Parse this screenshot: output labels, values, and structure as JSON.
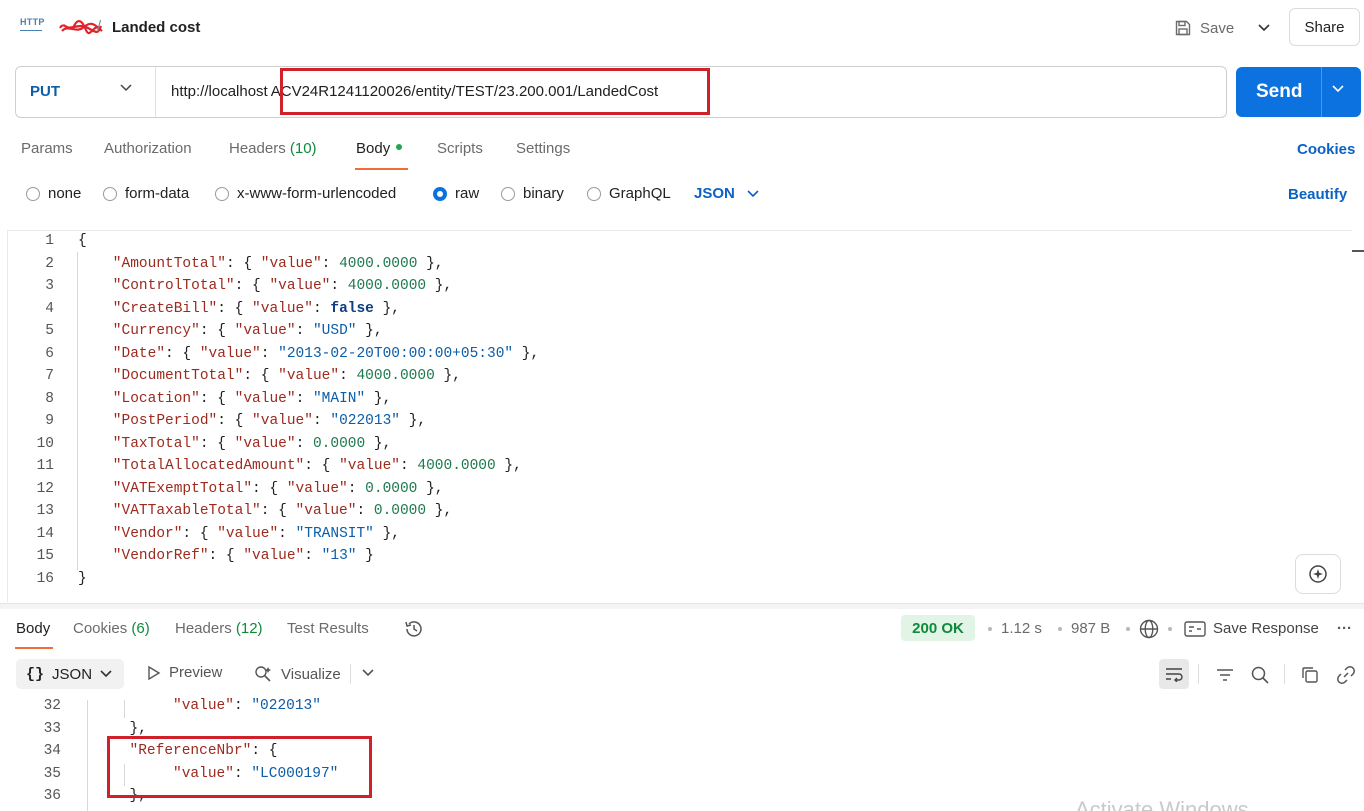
{
  "header": {
    "title": "Landed cost",
    "save_label": "Save",
    "share_label": "Share"
  },
  "request": {
    "method": "PUT",
    "url_prefix": "http://localhost",
    "url_path": "ACV24R1241120026/entity/TEST/23.200.001/LandedCost",
    "send_label": "Send"
  },
  "request_tabs": {
    "params": "Params",
    "authorization": "Authorization",
    "headers": "Headers",
    "headers_count": "(10)",
    "body": "Body",
    "scripts": "Scripts",
    "settings": "Settings",
    "cookies": "Cookies"
  },
  "body_types": {
    "none": "none",
    "form_data": "form-data",
    "urlencoded": "x-www-form-urlencoded",
    "raw": "raw",
    "binary": "binary",
    "graphql": "GraphQL",
    "language": "JSON",
    "beautify": "Beautify",
    "selected": "raw"
  },
  "request_body": {
    "line_numbers": [
      "1",
      "2",
      "3",
      "4",
      "5",
      "6",
      "7",
      "8",
      "9",
      "10",
      "11",
      "12",
      "13",
      "14",
      "15",
      "16"
    ],
    "lines": [
      [
        {
          "t": "p",
          "v": "{"
        }
      ],
      [
        {
          "t": "k",
          "v": "    \"AmountTotal\""
        },
        {
          "t": "p",
          "v": ": { "
        },
        {
          "t": "k",
          "v": "\"value\""
        },
        {
          "t": "p",
          "v": ": "
        },
        {
          "t": "n",
          "v": "4000.0000"
        },
        {
          "t": "p",
          "v": " },"
        }
      ],
      [
        {
          "t": "k",
          "v": "    \"ControlTotal\""
        },
        {
          "t": "p",
          "v": ": { "
        },
        {
          "t": "k",
          "v": "\"value\""
        },
        {
          "t": "p",
          "v": ": "
        },
        {
          "t": "n",
          "v": "4000.0000"
        },
        {
          "t": "p",
          "v": " },"
        }
      ],
      [
        {
          "t": "k",
          "v": "    \"CreateBill\""
        },
        {
          "t": "p",
          "v": ": { "
        },
        {
          "t": "k",
          "v": "\"value\""
        },
        {
          "t": "p",
          "v": ": "
        },
        {
          "t": "b",
          "v": "false"
        },
        {
          "t": "p",
          "v": " },"
        }
      ],
      [
        {
          "t": "k",
          "v": "    \"Currency\""
        },
        {
          "t": "p",
          "v": ": { "
        },
        {
          "t": "k",
          "v": "\"value\""
        },
        {
          "t": "p",
          "v": ": "
        },
        {
          "t": "s",
          "v": "\"USD\""
        },
        {
          "t": "p",
          "v": " },"
        }
      ],
      [
        {
          "t": "k",
          "v": "    \"Date\""
        },
        {
          "t": "p",
          "v": ": { "
        },
        {
          "t": "k",
          "v": "\"value\""
        },
        {
          "t": "p",
          "v": ": "
        },
        {
          "t": "s",
          "v": "\"2013-02-20T00:00:00+05:30\""
        },
        {
          "t": "p",
          "v": " },"
        }
      ],
      [
        {
          "t": "k",
          "v": "    \"DocumentTotal\""
        },
        {
          "t": "p",
          "v": ": { "
        },
        {
          "t": "k",
          "v": "\"value\""
        },
        {
          "t": "p",
          "v": ": "
        },
        {
          "t": "n",
          "v": "4000.0000"
        },
        {
          "t": "p",
          "v": " },"
        }
      ],
      [
        {
          "t": "k",
          "v": "    \"Location\""
        },
        {
          "t": "p",
          "v": ": { "
        },
        {
          "t": "k",
          "v": "\"value\""
        },
        {
          "t": "p",
          "v": ": "
        },
        {
          "t": "s",
          "v": "\"MAIN\""
        },
        {
          "t": "p",
          "v": " },"
        }
      ],
      [
        {
          "t": "k",
          "v": "    \"PostPeriod\""
        },
        {
          "t": "p",
          "v": ": { "
        },
        {
          "t": "k",
          "v": "\"value\""
        },
        {
          "t": "p",
          "v": ": "
        },
        {
          "t": "s",
          "v": "\"022013\""
        },
        {
          "t": "p",
          "v": " },"
        }
      ],
      [
        {
          "t": "k",
          "v": "    \"TaxTotal\""
        },
        {
          "t": "p",
          "v": ": { "
        },
        {
          "t": "k",
          "v": "\"value\""
        },
        {
          "t": "p",
          "v": ": "
        },
        {
          "t": "n",
          "v": "0.0000"
        },
        {
          "t": "p",
          "v": " },"
        }
      ],
      [
        {
          "t": "k",
          "v": "    \"TotalAllocatedAmount\""
        },
        {
          "t": "p",
          "v": ": { "
        },
        {
          "t": "k",
          "v": "\"value\""
        },
        {
          "t": "p",
          "v": ": "
        },
        {
          "t": "n",
          "v": "4000.0000"
        },
        {
          "t": "p",
          "v": " },"
        }
      ],
      [
        {
          "t": "k",
          "v": "    \"VATExemptTotal\""
        },
        {
          "t": "p",
          "v": ": { "
        },
        {
          "t": "k",
          "v": "\"value\""
        },
        {
          "t": "p",
          "v": ": "
        },
        {
          "t": "n",
          "v": "0.0000"
        },
        {
          "t": "p",
          "v": " },"
        }
      ],
      [
        {
          "t": "k",
          "v": "    \"VATTaxableTotal\""
        },
        {
          "t": "p",
          "v": ": { "
        },
        {
          "t": "k",
          "v": "\"value\""
        },
        {
          "t": "p",
          "v": ": "
        },
        {
          "t": "n",
          "v": "0.0000"
        },
        {
          "t": "p",
          "v": " },"
        }
      ],
      [
        {
          "t": "k",
          "v": "    \"Vendor\""
        },
        {
          "t": "p",
          "v": ": { "
        },
        {
          "t": "k",
          "v": "\"value\""
        },
        {
          "t": "p",
          "v": ": "
        },
        {
          "t": "s",
          "v": "\"TRANSIT\""
        },
        {
          "t": "p",
          "v": " },"
        }
      ],
      [
        {
          "t": "k",
          "v": "    \"VendorRef\""
        },
        {
          "t": "p",
          "v": ": { "
        },
        {
          "t": "k",
          "v": "\"value\""
        },
        {
          "t": "p",
          "v": ": "
        },
        {
          "t": "s",
          "v": "\"13\""
        },
        {
          "t": "p",
          "v": " }"
        }
      ],
      [
        {
          "t": "p",
          "v": "}"
        }
      ]
    ]
  },
  "response_tabs": {
    "body": "Body",
    "cookies": "Cookies",
    "cookies_count": "(6)",
    "headers": "Headers",
    "headers_count": "(12)",
    "test_results": "Test Results"
  },
  "response_meta": {
    "status": "200 OK",
    "time": "1.12 s",
    "size": "987 B",
    "save_response": "Save Response"
  },
  "response_toolbar": {
    "format": "JSON",
    "preview": "Preview",
    "visualize": "Visualize"
  },
  "response_body": {
    "line_numbers": [
      "32",
      "33",
      "34",
      "35",
      "36"
    ],
    "lines": [
      [
        {
          "t": "p",
          "v": "          "
        },
        {
          "t": "k",
          "v": "\"value\""
        },
        {
          "t": "p",
          "v": ": "
        },
        {
          "t": "s",
          "v": "\"022013\""
        }
      ],
      [
        {
          "t": "p",
          "v": "     },"
        }
      ],
      [
        {
          "t": "p",
          "v": "     "
        },
        {
          "t": "k",
          "v": "\"ReferenceNbr\""
        },
        {
          "t": "p",
          "v": ": {"
        }
      ],
      [
        {
          "t": "p",
          "v": "          "
        },
        {
          "t": "k",
          "v": "\"value\""
        },
        {
          "t": "p",
          "v": ": "
        },
        {
          "t": "s",
          "v": "\"LC000197\""
        }
      ],
      [
        {
          "t": "p",
          "v": "     },"
        }
      ]
    ]
  },
  "watermark": "Activate Windows",
  "colors": {
    "accent": "#0b72e0",
    "highlight_box": "#d0202a",
    "status_ok": "#0f8a3c",
    "tab_underline": "#f26b3a"
  }
}
